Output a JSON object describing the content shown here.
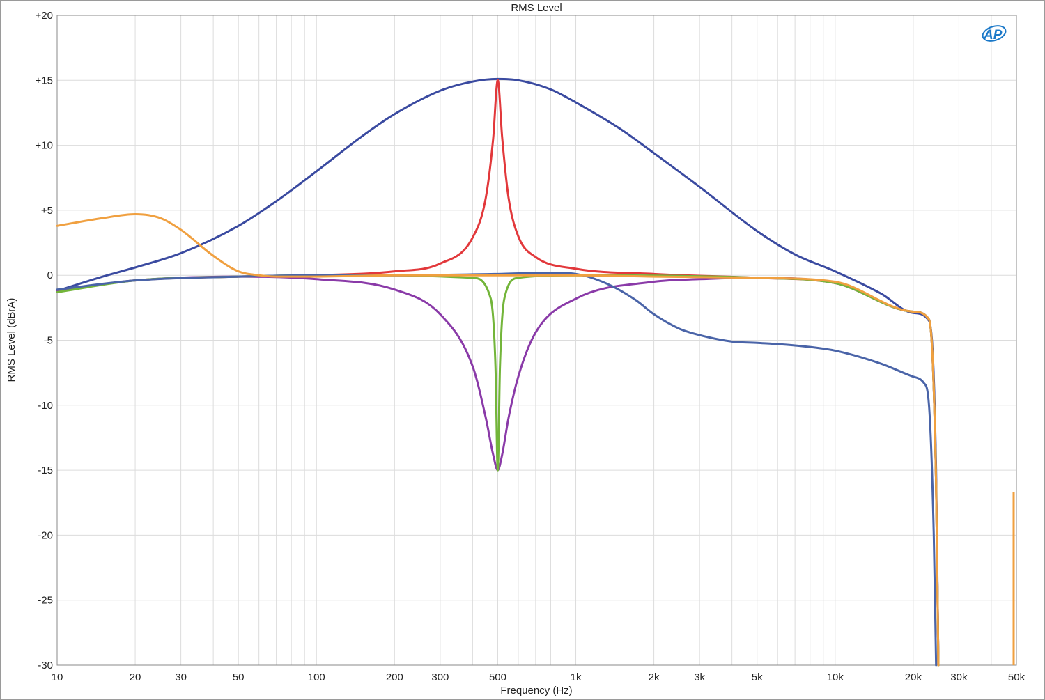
{
  "chart_data": {
    "type": "line",
    "title": "RMS Level",
    "xlabel": "Frequency (Hz)",
    "ylabel": "RMS Level (dBrA)",
    "xscale": "log",
    "xlim": [
      10,
      50000
    ],
    "ylim": [
      -30,
      20
    ],
    "grid": true,
    "logo": "AP",
    "x_ticks": [
      {
        "value": 10,
        "label": "10"
      },
      {
        "value": 20,
        "label": "20"
      },
      {
        "value": 30,
        "label": "30"
      },
      {
        "value": 50,
        "label": "50"
      },
      {
        "value": 100,
        "label": "100"
      },
      {
        "value": 200,
        "label": "200"
      },
      {
        "value": 300,
        "label": "300"
      },
      {
        "value": 500,
        "label": "500"
      },
      {
        "value": 1000,
        "label": "1k"
      },
      {
        "value": 2000,
        "label": "2k"
      },
      {
        "value": 3000,
        "label": "3k"
      },
      {
        "value": 5000,
        "label": "5k"
      },
      {
        "value": 10000,
        "label": "10k"
      },
      {
        "value": 20000,
        "label": "20k"
      },
      {
        "value": 30000,
        "label": "30k"
      },
      {
        "value": 50000,
        "label": "50k"
      }
    ],
    "y_ticks": [
      {
        "value": 20,
        "label": "+20"
      },
      {
        "value": 15,
        "label": "+15"
      },
      {
        "value": 10,
        "label": "+10"
      },
      {
        "value": 5,
        "label": "+5"
      },
      {
        "value": 0,
        "label": "0"
      },
      {
        "value": -5,
        "label": "-5"
      },
      {
        "value": -10,
        "label": "-10"
      },
      {
        "value": -15,
        "label": "-15"
      },
      {
        "value": -20,
        "label": "-20"
      },
      {
        "value": -25,
        "label": "-25"
      },
      {
        "value": -30,
        "label": "-30"
      }
    ],
    "series": [
      {
        "color": "#3a4aa0",
        "x": [
          10,
          15,
          20,
          30,
          50,
          70,
          100,
          150,
          200,
          300,
          400,
          500,
          600,
          800,
          1000,
          1500,
          2000,
          3000,
          5000,
          7000,
          10000,
          15000,
          20000,
          23000,
          24500,
          25000
        ],
        "y": [
          -1.2,
          -0.1,
          0.6,
          1.7,
          3.8,
          5.7,
          8.0,
          10.7,
          12.4,
          14.2,
          14.9,
          15.1,
          15.0,
          14.3,
          13.3,
          11.2,
          9.4,
          6.8,
          3.4,
          1.6,
          0.3,
          -1.4,
          -2.9,
          -3.5,
          -15,
          -30
        ]
      },
      {
        "color": "#e2383b",
        "x": [
          10,
          20,
          50,
          100,
          200,
          300,
          400,
          450,
          480,
          500,
          520,
          550,
          600,
          700,
          1000,
          2000,
          5000,
          10000,
          20000,
          23000,
          24500,
          25000
        ],
        "y": [
          -1.2,
          -0.4,
          -0.1,
          0.0,
          0.3,
          0.9,
          2.9,
          6.0,
          10.5,
          15.0,
          10.6,
          6.0,
          3.0,
          1.4,
          0.5,
          0.1,
          -0.2,
          -0.6,
          -2.8,
          -3.4,
          -16,
          -30
        ]
      },
      {
        "color": "#8a3aa8",
        "x": [
          10,
          20,
          50,
          100,
          200,
          300,
          400,
          450,
          480,
          500,
          520,
          550,
          600,
          700,
          1000,
          2000,
          3000,
          5000,
          10000,
          20000,
          23000,
          24500,
          25000
        ],
        "y": [
          -1.2,
          -0.4,
          -0.1,
          -0.3,
          -1.1,
          -3.0,
          -7.0,
          -11.0,
          -13.8,
          -15.0,
          -13.8,
          -11.0,
          -7.8,
          -4.4,
          -1.8,
          -0.5,
          -0.3,
          -0.2,
          -0.6,
          -2.8,
          -3.4,
          -16,
          -30
        ]
      },
      {
        "color": "#73b53a",
        "x": [
          10,
          20,
          50,
          100,
          200,
          400,
          470,
          490,
          500,
          510,
          530,
          600,
          1000,
          5000,
          10000,
          20000,
          23000,
          24500,
          25000
        ],
        "y": [
          -1.3,
          -0.4,
          -0.1,
          0.0,
          0.0,
          -0.2,
          -1.8,
          -7.0,
          -15.0,
          -7.0,
          -1.8,
          -0.2,
          0.0,
          -0.2,
          -0.6,
          -2.8,
          -3.4,
          -16,
          -30
        ]
      },
      {
        "color": "#4a64a8",
        "x": [
          10,
          20,
          50,
          100,
          200,
          500,
          800,
          1000,
          1300,
          1700,
          2000,
          2500,
          3000,
          4000,
          5000,
          7000,
          10000,
          15000,
          20000,
          22000,
          23000,
          24000,
          24500
        ],
        "y": [
          -1.1,
          -0.4,
          -0.1,
          0.0,
          0.0,
          0.1,
          0.2,
          0.1,
          -0.6,
          -1.9,
          -3.0,
          -4.1,
          -4.6,
          -5.1,
          -5.2,
          -5.4,
          -5.8,
          -6.8,
          -7.8,
          -8.3,
          -10,
          -20,
          -30
        ]
      },
      {
        "color": "#f0a040",
        "x": [
          10,
          15,
          20,
          25,
          30,
          40,
          50,
          60,
          70,
          100,
          200,
          500,
          1000,
          2000,
          5000,
          10000,
          20000,
          23000,
          24500,
          25000
        ],
        "y": [
          3.8,
          4.4,
          4.7,
          4.4,
          3.5,
          1.5,
          0.3,
          0.0,
          -0.1,
          -0.1,
          0.0,
          0.0,
          0.0,
          -0.1,
          -0.2,
          -0.5,
          -2.8,
          -3.4,
          -16,
          -30
        ]
      }
    ]
  }
}
